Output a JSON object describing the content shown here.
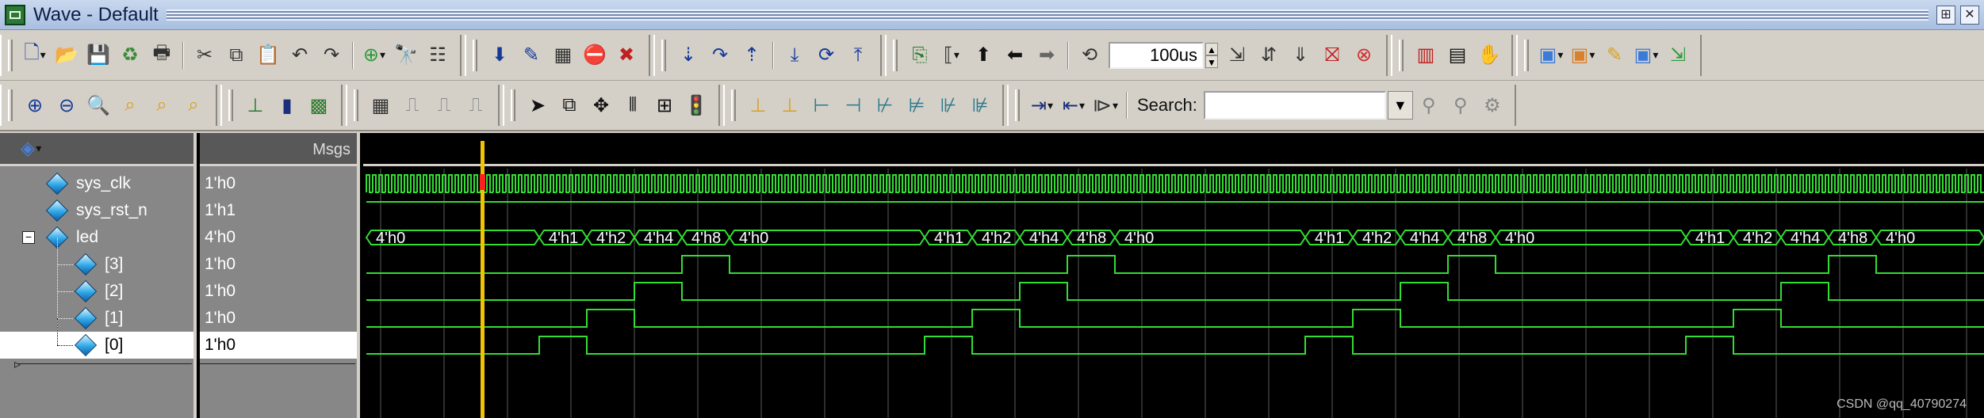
{
  "window": {
    "title": "Wave - Default"
  },
  "toolbar1": {
    "groups": [
      [
        "new-file-icon",
        "open-folder-icon",
        "save-icon",
        "reload-icon",
        "print-icon"
      ],
      [
        "cut-icon",
        "copy-icon",
        "paste-icon",
        "undo-icon",
        "redo-icon"
      ],
      [
        "add-icon",
        "find-icon",
        "format-icon"
      ]
    ],
    "time_step": "100us"
  },
  "toolbar2": {
    "search_label": "Search:",
    "search_value": ""
  },
  "wave": {
    "msgs_header": "Msgs",
    "signals": [
      {
        "name": "sys_clk",
        "value": "1'h0"
      },
      {
        "name": "sys_rst_n",
        "value": "1'h1"
      },
      {
        "name": "led",
        "value": "4'h0"
      },
      {
        "name": "[3]",
        "value": "1'h0"
      },
      {
        "name": "[2]",
        "value": "1'h0"
      },
      {
        "name": "[1]",
        "value": "1'h0"
      },
      {
        "name": "[0]",
        "value": "1'h0"
      }
    ],
    "led_bus_labels": [
      "4'h0",
      "4'h1",
      "4'h2",
      "4'h4",
      "4'h8",
      "4'h0",
      "4'h1",
      "4'h2",
      "4'h4",
      "4'h8",
      "4'h0",
      "4'h1",
      "4'h2",
      "4'h4",
      "4'h8",
      "4'h0",
      "4'h1",
      "4'h2",
      "4'h4",
      "4'h8",
      "4'h0"
    ],
    "colors": {
      "wave": "#33dd33",
      "cursor": "#f2c400",
      "clk_cursor_mark": "#ff2020",
      "grid": "#5a5a5a"
    }
  },
  "watermark": "CSDN @qq_40790274"
}
